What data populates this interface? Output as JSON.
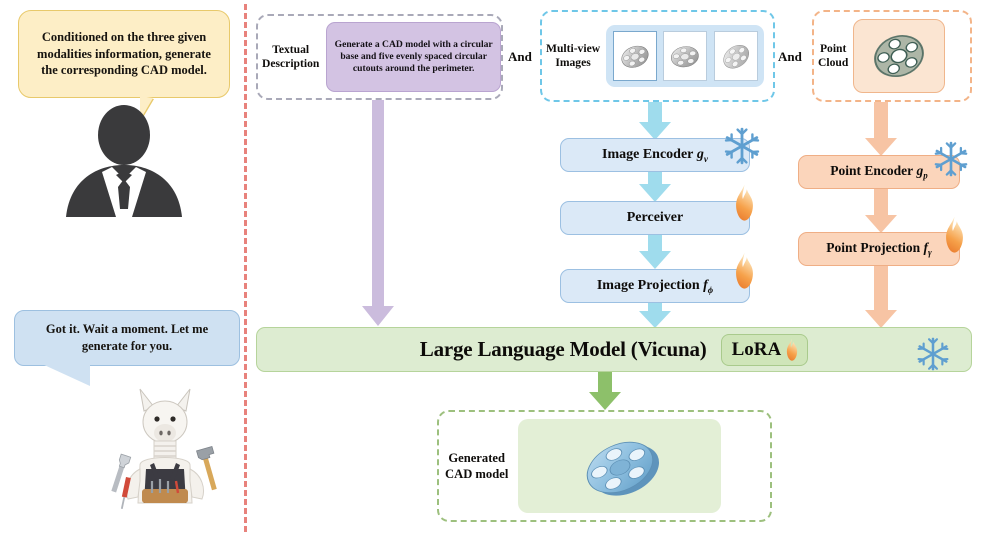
{
  "left_panel": {
    "user_bubble": "Conditioned on the three given modalities information, generate the corresponding CAD model.",
    "user_icon": "user-silhouette-icon",
    "assistant_bubble": "Got it. Wait a moment. Let me generate for you.",
    "assistant_icon": "llama-mascot-icon"
  },
  "inputs": {
    "textual": {
      "label": "Textual\nDescription",
      "label_line1": "Textual",
      "label_line2": "Description",
      "prompt": "Generate a CAD model with a circular base and five evenly spaced circular cutouts around the perimeter.",
      "card_color": "#d3c3e3",
      "border_color": "#a9a9b8"
    },
    "connector_1": "And",
    "multiview": {
      "label_line1": "Multi-view",
      "label_line2": "Images",
      "thumbnails": [
        "view-1",
        "view-2",
        "view-3"
      ],
      "card_color": "#cfe4f5",
      "border_color": "#6fc7e8"
    },
    "connector_2": "And",
    "pointcloud": {
      "label_line1": "Point",
      "label_line2": "Cloud",
      "thumbnail": "point-cloud-wheel",
      "card_color": "#fbe5d2",
      "border_color": "#f3b488"
    }
  },
  "image_branch": {
    "encoder": {
      "name": "Image Encoder",
      "symbol": "g",
      "subscript": "v",
      "state": "frozen",
      "state_icon": "snowflake-icon"
    },
    "perceiver": {
      "name": "Perceiver",
      "symbol": "",
      "subscript": "",
      "state": "trainable",
      "state_icon": "flame-icon"
    },
    "projection": {
      "name": "Image Projection",
      "symbol": "f",
      "subscript": "ϕ",
      "state": "trainable",
      "state_icon": "flame-icon"
    },
    "arrow_color": "#9fdced"
  },
  "point_branch": {
    "encoder": {
      "name": "Point Encoder",
      "symbol": "g",
      "subscript": "p",
      "state": "frozen",
      "state_icon": "snowflake-icon"
    },
    "projection": {
      "name": "Point Projection",
      "symbol": "f",
      "subscript": "γ",
      "state": "trainable",
      "state_icon": "flame-icon"
    },
    "arrow_color": "#f7c4a4"
  },
  "text_branch": {
    "arrow_color": "#cbbcdd"
  },
  "llm": {
    "title": "Large Language Model (Vicuna)",
    "adapter": "LoRA",
    "adapter_icon": "flame-icon",
    "state": "frozen",
    "state_icon": "snowflake-icon",
    "bar_color": "#ddecd1",
    "border_color": "#b6d49b"
  },
  "output": {
    "label_line1": "Generated",
    "label_line2": "CAD model",
    "model_icon": "cad-wheel-model",
    "card_color": "#e3efd6",
    "border_color": "#9dc07e",
    "arrow_color": "#8dc06a"
  },
  "divider": {
    "name": "section-divider",
    "color": "#e8827c",
    "style": "dashed-vertical"
  }
}
